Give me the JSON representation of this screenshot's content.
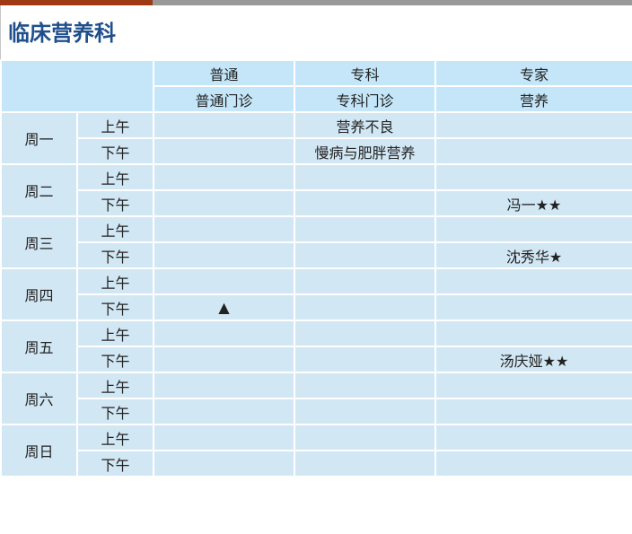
{
  "page": {
    "title": "临床营养科"
  },
  "header": {
    "row1": [
      "普通",
      "专科",
      "专家"
    ],
    "row2": [
      "普通门诊",
      "专科门诊",
      "营养"
    ]
  },
  "schedule": [
    {
      "day": "周一",
      "slots": [
        {
          "period": "上午",
          "cells": [
            "",
            "营养不良",
            ""
          ]
        },
        {
          "period": "下午",
          "cells": [
            "",
            "慢病与肥胖营养",
            ""
          ]
        }
      ]
    },
    {
      "day": "周二",
      "slots": [
        {
          "period": "上午",
          "cells": [
            "",
            "",
            ""
          ]
        },
        {
          "period": "下午",
          "cells": [
            "",
            "",
            "冯一★★"
          ]
        }
      ]
    },
    {
      "day": "周三",
      "slots": [
        {
          "period": "上午",
          "cells": [
            "",
            "",
            ""
          ]
        },
        {
          "period": "下午",
          "cells": [
            "",
            "",
            "沈秀华★"
          ]
        }
      ]
    },
    {
      "day": "周四",
      "slots": [
        {
          "period": "上午",
          "cells": [
            "",
            "",
            ""
          ]
        },
        {
          "period": "下午",
          "cells": [
            "▲",
            "",
            ""
          ]
        }
      ]
    },
    {
      "day": "周五",
      "slots": [
        {
          "period": "上午",
          "cells": [
            "",
            "",
            ""
          ]
        },
        {
          "period": "下午",
          "cells": [
            "",
            "",
            "汤庆娅★★"
          ]
        }
      ]
    },
    {
      "day": "周六",
      "slots": [
        {
          "period": "上午",
          "cells": [
            "",
            "",
            ""
          ]
        },
        {
          "period": "下午",
          "cells": [
            "",
            "",
            ""
          ]
        }
      ]
    },
    {
      "day": "周日",
      "slots": [
        {
          "period": "上午",
          "cells": [
            "",
            "",
            ""
          ]
        },
        {
          "period": "下午",
          "cells": [
            "",
            "",
            ""
          ]
        }
      ]
    }
  ],
  "colors": {
    "title": "#1f4f8c",
    "accent_bar": "#9e3a14",
    "header_bg": "#c4e6f8",
    "cell_bg": "#d2e7f4"
  }
}
